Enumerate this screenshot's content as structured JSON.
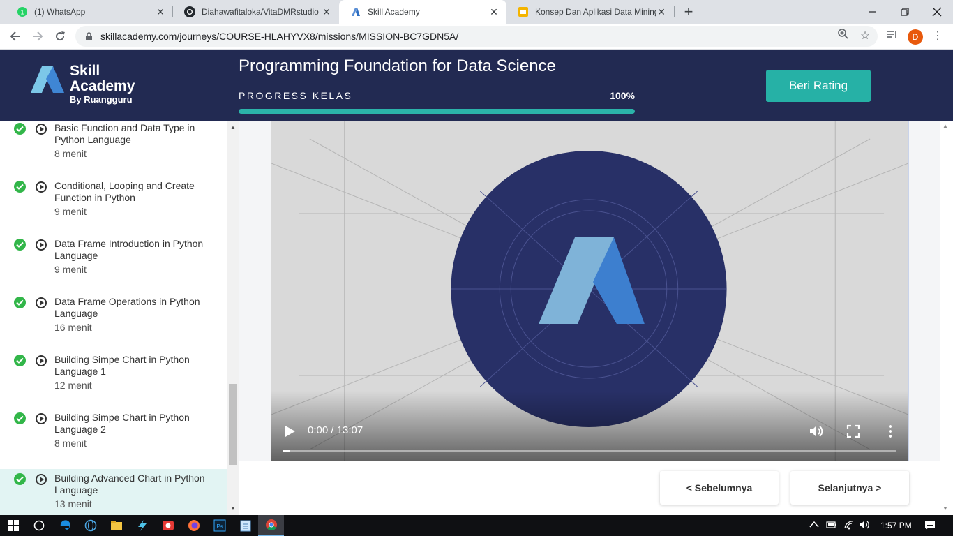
{
  "browser": {
    "tabs": [
      {
        "title": "(1) WhatsApp",
        "favicon": "whatsapp-icon",
        "badge": "1"
      },
      {
        "title": "Diahawafitaloka/VitaDMRstudio",
        "favicon": "github-icon"
      },
      {
        "title": "Skill Academy",
        "favicon": "skill-academy-icon"
      },
      {
        "title": "Konsep Dan Aplikasi Data Mining",
        "favicon": "slides-icon"
      }
    ],
    "url": "skillacademy.com/journeys/COURSE-HLAHYVX8/missions/MISSION-BC7GDN5A/",
    "profile_initial": "D"
  },
  "header": {
    "logo_line1": "Skill",
    "logo_line2": "Academy",
    "logo_by": "By Ruangguru",
    "course_title": "Programming Foundation for Data Science",
    "progress_label": "PROGRESS KELAS",
    "progress_value": "100%",
    "progress_fraction": 1.0,
    "rating_button": "Beri Rating"
  },
  "lessons": [
    {
      "title": "Basic Function and Data Type in Python Language",
      "duration": "8 menit",
      "done": true
    },
    {
      "title": "Conditional, Looping and Create Function in Python",
      "duration": "9 menit",
      "done": true
    },
    {
      "title": "Data Frame Introduction in Python Language",
      "duration": "9 menit",
      "done": true
    },
    {
      "title": "Data Frame Operations in Python Language",
      "duration": "16 menit",
      "done": true
    },
    {
      "title": "Building Simpe Chart in Python Language 1",
      "duration": "12 menit",
      "done": true
    },
    {
      "title": "Building Simpe Chart in Python Language 2",
      "duration": "8 menit",
      "done": true
    },
    {
      "title": "Building Advanced Chart in Python Language",
      "duration": "13 menit",
      "done": true,
      "active": true
    }
  ],
  "video": {
    "time": "0:00 / 13:07",
    "played_fraction": 0.01
  },
  "nav": {
    "prev": "<  Sebelumnya",
    "next": "Selanjutnya  >"
  },
  "taskbar": {
    "clock": "1:57 PM"
  },
  "colors": {
    "header_bg": "#222a52",
    "accent": "#26b1a6",
    "check": "#32b649"
  }
}
